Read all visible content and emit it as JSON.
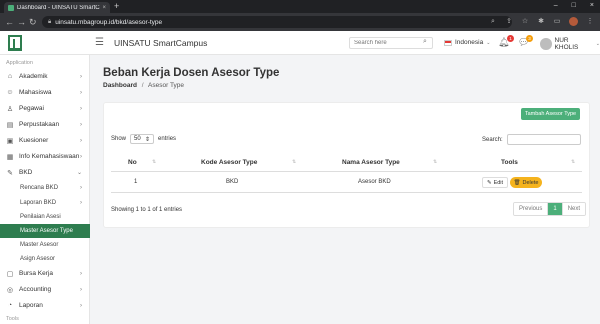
{
  "browser": {
    "tab_title": "Dashboard - UINSATU SmartCam...",
    "tab_close": "×",
    "new_tab": "+",
    "url": "uinsatu.mbagroup.id/bkd/asesor-type",
    "win_controls": [
      "–",
      "□",
      "×"
    ]
  },
  "header": {
    "app_title": "UINSATU SmartCampus",
    "search_placeholder": "Search here",
    "language": "Indonesia",
    "notif_count": "1",
    "message_count": "3",
    "user_name": "NUR KHOLIS"
  },
  "sidebar": {
    "section_application": "Application",
    "section_tools": "Tools",
    "items": [
      {
        "label": "Akademik",
        "icon": "graduation-icon"
      },
      {
        "label": "Mahasiswa",
        "icon": "users-icon"
      },
      {
        "label": "Pegawai",
        "icon": "user-icon"
      },
      {
        "label": "Perpustakaan",
        "icon": "library-icon"
      },
      {
        "label": "Kuesioner",
        "icon": "questionnaire-icon"
      },
      {
        "label": "Info Kemahasiswaan",
        "icon": "info-icon"
      },
      {
        "label": "BKD",
        "icon": "bkd-icon"
      }
    ],
    "bkd_sub": [
      {
        "label": "Rencana BKD"
      },
      {
        "label": "Laporan BKD"
      },
      {
        "label": "Penilaian Asesi"
      },
      {
        "label": "Master Asesor Type"
      },
      {
        "label": "Master Asesor"
      },
      {
        "label": "Asign Asesor"
      }
    ],
    "items_after": [
      {
        "label": "Bursa Kerja",
        "icon": "briefcase-icon"
      },
      {
        "label": "Accounting",
        "icon": "accounting-icon"
      },
      {
        "label": "Laporan",
        "icon": "report-icon"
      }
    ]
  },
  "page": {
    "title": "Beban Kerja Dosen Asesor Type",
    "breadcrumb_root": "Dashboard",
    "breadcrumb_sep": "/",
    "breadcrumb_current": "Asesor Type",
    "add_button": "Tambah Asesor Type",
    "show_label": "Show",
    "show_value": "50",
    "entries_label": "entries",
    "search_label": "Search:"
  },
  "table": {
    "headers": [
      "No",
      "Kode Asesor Type",
      "Nama Asesor Type",
      "Tools"
    ],
    "rows": [
      {
        "no": "1",
        "kode": "BKD",
        "nama": "Asesor BKD"
      }
    ],
    "edit_label": "Edit",
    "delete_label": "Delete",
    "info": "Showing 1 to 1 of 1 entries",
    "pagination": {
      "previous": "Previous",
      "current": "1",
      "next": "Next"
    }
  },
  "colors": {
    "accent": "#2e7d4f",
    "button": "#4caf7a",
    "delete": "#f5b31d"
  }
}
